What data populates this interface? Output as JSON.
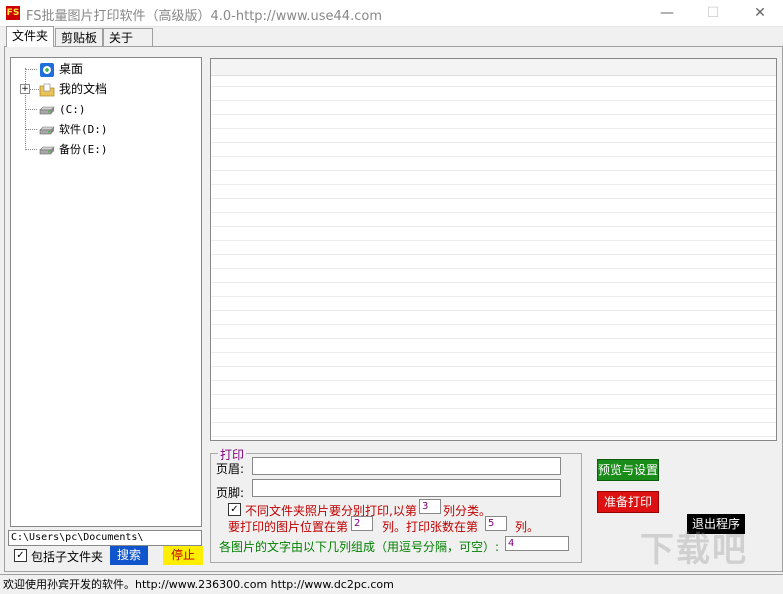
{
  "window": {
    "title": "FS批量图片打印软件（高级版）4.0-http://www.use44.com",
    "app_icon_text": "FS",
    "minimize": "—",
    "maximize": "☐",
    "close": "✕"
  },
  "tabs": [
    {
      "label": "文件夹"
    },
    {
      "label": "剪贴板"
    },
    {
      "label": "关于"
    }
  ],
  "tree": {
    "items": [
      {
        "label": "桌面",
        "icon": "desktop-icon"
      },
      {
        "label": "我的文档",
        "icon": "folder-icon",
        "expander": "+"
      },
      {
        "label": "(C:)",
        "icon": "drive-icon"
      },
      {
        "label": "软件(D:)",
        "icon": "drive-icon"
      },
      {
        "label": "备份(E:)",
        "icon": "drive-icon"
      }
    ]
  },
  "path": {
    "value": "C:\\Users\\pc\\Documents\\"
  },
  "include_subfolders": {
    "label": "包括子文件夹",
    "checked": true,
    "mark": "✓"
  },
  "buttons": {
    "search": "搜索",
    "stop": "停止",
    "preview": "预览与设置",
    "print": "准备打印",
    "exit": "退出程序"
  },
  "print_group": {
    "legend": "打印",
    "header_label": "页眉:",
    "header_value": "",
    "footer_label": "页脚:",
    "footer_value": "",
    "separate_checkbox": {
      "checked": true,
      "mark": "✓",
      "text_before": "不同文件夹照片要分别打印,以第",
      "value": "3",
      "text_after": "列分类。"
    },
    "image_column": {
      "text_before": "要打印的图片位置在第",
      "value": "2",
      "text_mid": "列。打印张数在第",
      "count_value": "5",
      "text_after": "列。"
    },
    "caption_columns": {
      "text": "各图片的文字由以下几列组成（用逗号分隔，可空）:",
      "value": "4"
    }
  },
  "status": {
    "text": "欢迎使用孙宾开发的软件。http://www.236300.com http://www.dc2pc.com"
  },
  "watermark": {
    "text": "下载吧"
  },
  "colors": {
    "preview_bg": "#1a8c1a",
    "print_bg": "#dd1111",
    "search_bg": "#1155cc",
    "stop_bg": "#ffee00",
    "exit_bg": "#000000",
    "label_red": "#c00000",
    "label_green": "#008000",
    "legend_purple": "#800080"
  }
}
